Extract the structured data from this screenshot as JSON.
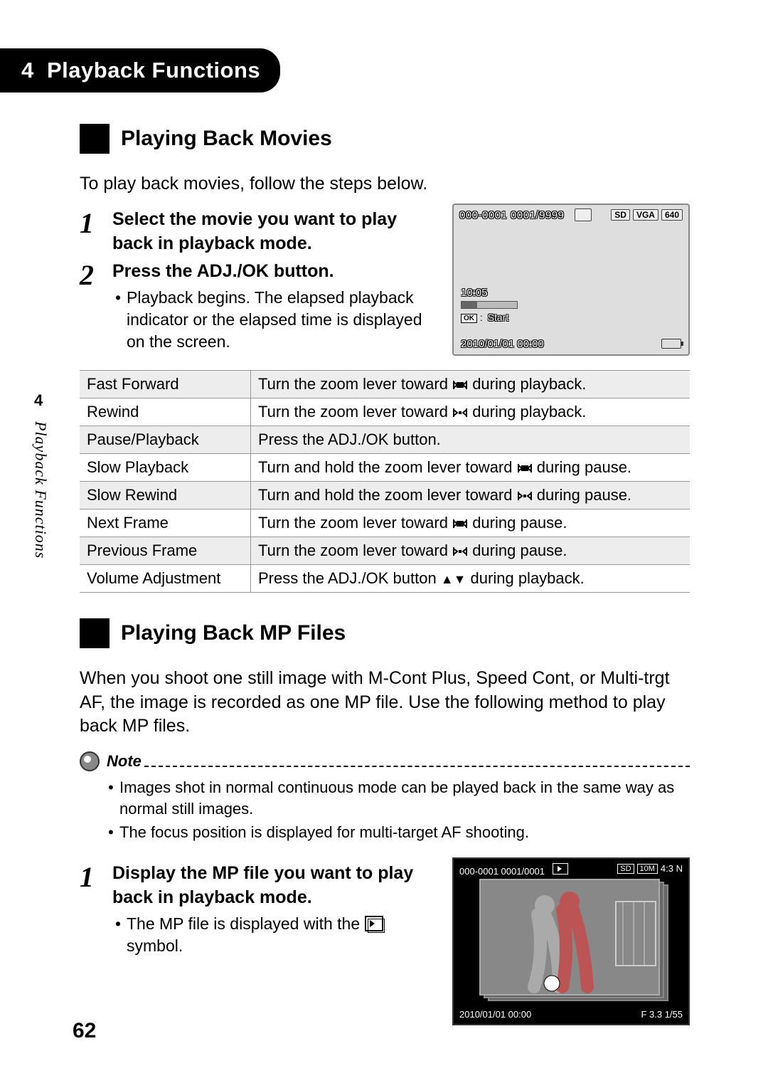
{
  "chapter": {
    "number": "4",
    "title": "Playback Functions"
  },
  "side": {
    "tabNumber": "4",
    "label": "Playback Functions"
  },
  "pageNumber": "62",
  "section1": {
    "title": "Playing Back Movies",
    "intro": "To play back movies, follow the steps below.",
    "steps": [
      {
        "num": "1",
        "title": "Select the movie you want to play back in playback mode."
      },
      {
        "num": "2",
        "title": "Press the ADJ./OK button.",
        "bullet": "Playback begins. The elapsed playback indicator or the elapsed time is displayed on the screen."
      }
    ],
    "screen": {
      "fileCounter": "000-0001 0001/9999",
      "sd": "SD",
      "vga": "VGA",
      "res": "640",
      "elapsed": "10:05",
      "ok": "OK",
      "start": "Start",
      "datetime": "2010/01/01 00:00"
    },
    "table": [
      {
        "action": "Fast Forward",
        "desc_pre": "Turn the zoom lever toward ",
        "icon": "tele",
        "desc_post": " during playback."
      },
      {
        "action": "Rewind",
        "desc_pre": "Turn the zoom lever toward ",
        "icon": "wide",
        "desc_post": " during playback."
      },
      {
        "action": "Pause/Playback",
        "desc_pre": "Press the ADJ./OK button.",
        "icon": "",
        "desc_post": ""
      },
      {
        "action": "Slow Playback",
        "desc_pre": "Turn and hold the zoom lever toward ",
        "icon": "tele",
        "desc_post": " during pause."
      },
      {
        "action": "Slow Rewind",
        "desc_pre": "Turn and hold the zoom lever toward ",
        "icon": "wide",
        "desc_post": " during pause."
      },
      {
        "action": "Next Frame",
        "desc_pre": "Turn the zoom lever toward ",
        "icon": "tele",
        "desc_post": " during pause."
      },
      {
        "action": "Previous Frame",
        "desc_pre": "Turn the zoom lever toward ",
        "icon": "wide",
        "desc_post": " during pause."
      },
      {
        "action": "Volume Adjustment",
        "desc_pre": "Press the ADJ./OK button ",
        "icon": "updown",
        "desc_post": " during playback."
      }
    ]
  },
  "section2": {
    "title": "Playing Back MP Files",
    "intro": "When you shoot one still image with M-Cont Plus, Speed Cont, or Multi-trgt AF, the image is recorded as one MP file. Use the following method to play back MP files.",
    "noteLabel": "Note",
    "notes": [
      "Images shot in normal continuous mode can be played back in the same way as normal still images.",
      "The focus position is displayed for multi-target AF shooting."
    ],
    "steps": [
      {
        "num": "1",
        "title": "Display the MP file you want to play back in playback mode.",
        "bullet_pre": "The MP file is displayed with the ",
        "bullet_post": " symbol."
      }
    ],
    "screen": {
      "fileCounter": "000-0001    0001/0001",
      "sd": "SD",
      "size": "10M",
      "ratio": "4:3 N",
      "datetime": "2010/01/01 00:00",
      "exposure": "F 3.3  1/55"
    }
  }
}
